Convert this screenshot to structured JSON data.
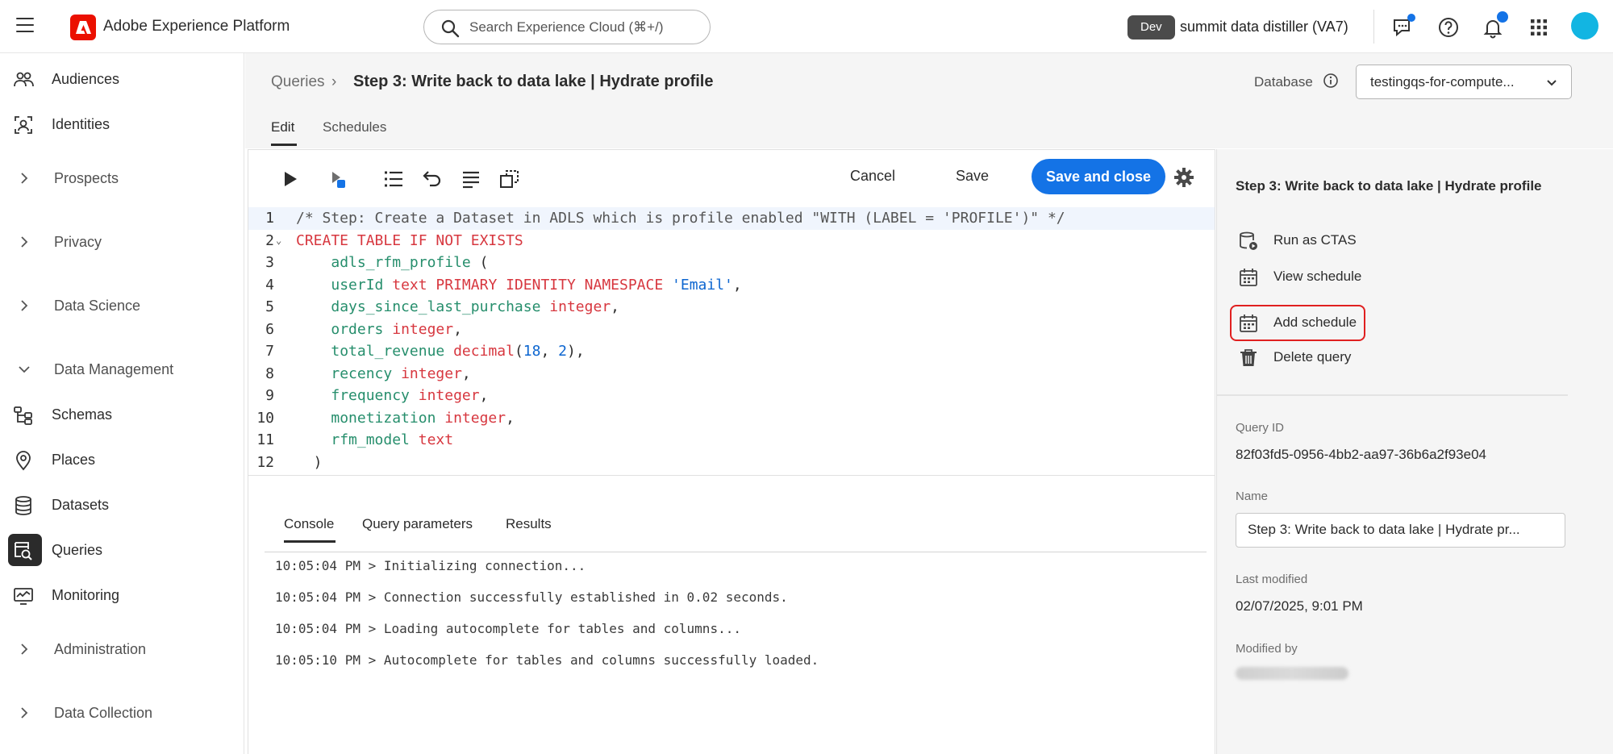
{
  "topbar": {
    "app_title": "Adobe Experience Platform",
    "search_placeholder": "Search Experience Cloud (⌘+/)",
    "env_badge": "Dev",
    "org_name": "summit data distiller (VA7)",
    "icons": [
      "feedback-icon",
      "help-icon",
      "notifications-icon",
      "apps-grid-icon",
      "avatar"
    ]
  },
  "sidebar": {
    "items": [
      {
        "label": "Audiences",
        "icon": "audiences-icon",
        "type": "link"
      },
      {
        "label": "Identities",
        "icon": "identities-icon",
        "type": "link"
      },
      {
        "label": "Prospects",
        "icon": "chevron-right-icon",
        "type": "group"
      },
      {
        "label": "Privacy",
        "icon": "chevron-right-icon",
        "type": "group"
      },
      {
        "label": "Data Science",
        "icon": "chevron-right-icon",
        "type": "group"
      },
      {
        "label": "Data Management",
        "icon": "chevron-down-icon",
        "type": "group"
      },
      {
        "label": "Schemas",
        "icon": "schemas-icon",
        "type": "link"
      },
      {
        "label": "Places",
        "icon": "places-icon",
        "type": "link"
      },
      {
        "label": "Datasets",
        "icon": "datasets-icon",
        "type": "link"
      },
      {
        "label": "Queries",
        "icon": "queries-icon",
        "type": "link",
        "active": true
      },
      {
        "label": "Monitoring",
        "icon": "monitoring-icon",
        "type": "link"
      },
      {
        "label": "Administration",
        "icon": "chevron-right-icon",
        "type": "group"
      },
      {
        "label": "Data Collection",
        "icon": "chevron-right-icon",
        "type": "group"
      }
    ]
  },
  "header": {
    "breadcrumb_root": "Queries",
    "breadcrumb_sep": "›",
    "title": "Step 3: Write back to data lake | Hydrate profile",
    "database_label": "Database",
    "database_value": "testingqs-for-compute..."
  },
  "tabs": [
    {
      "label": "Edit",
      "active": true
    },
    {
      "label": "Schedules",
      "active": false
    }
  ],
  "toolbar": {
    "cancel_label": "Cancel",
    "save_label": "Save",
    "save_close_label": "Save and close"
  },
  "editor": {
    "lines": [
      "/* Step: Create a Dataset in ADLS which is profile enabled \"WITH (LABEL = 'PROFILE')\" */",
      "CREATE TABLE IF NOT EXISTS",
      "    adls_rfm_profile (",
      "    userId text PRIMARY IDENTITY NAMESPACE 'Email',",
      "    days_since_last_purchase integer,",
      "    orders integer,",
      "    total_revenue decimal(18, 2),",
      "    recency integer,",
      "    frequency integer,",
      "    monetization integer,",
      "    rfm_model text",
      "  )"
    ]
  },
  "console": {
    "tabs": [
      "Console",
      "Query parameters",
      "Results"
    ],
    "logs": [
      "10:05:04 PM > Initializing connection...",
      "10:05:04 PM > Connection successfully established in 0.02 seconds.",
      "10:05:04 PM > Loading autocomplete for tables and columns...",
      "10:05:10 PM > Autocomplete for tables and columns successfully loaded."
    ]
  },
  "details": {
    "title": "Step 3: Write back to data lake | Hydrate profile",
    "actions": [
      {
        "label": "Run as CTAS",
        "icon": "run-ctas-icon"
      },
      {
        "label": "View schedule",
        "icon": "calendar-icon"
      },
      {
        "label": "Add schedule",
        "icon": "calendar-add-icon",
        "highlighted": true
      },
      {
        "label": "Delete query",
        "icon": "trash-icon"
      }
    ],
    "query_id_label": "Query ID",
    "query_id": "82f03fd5-0956-4bb2-aa97-36b6a2f93e04",
    "name_label": "Name",
    "name_value": "Step 3: Write back to data lake | Hydrate pr...",
    "last_modified_label": "Last modified",
    "last_modified": "02/07/2025, 9:01 PM",
    "modified_by_label": "Modified by"
  },
  "colors": {
    "accent": "#1473e6",
    "adobe_red": "#eb1000",
    "highlight_border": "#e02020",
    "keyword": "#d7373f",
    "identifier": "#268e6c"
  }
}
